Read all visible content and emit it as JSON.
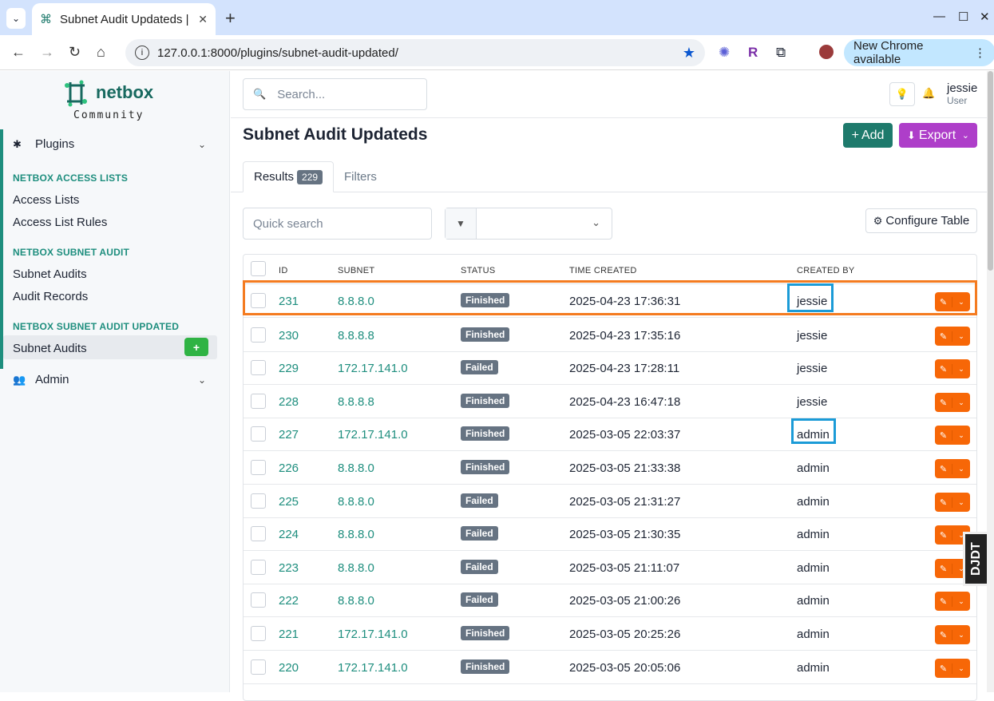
{
  "browser": {
    "tab_title": "Subnet Audit Updateds |",
    "url": "127.0.0.1:8000/plugins/subnet-audit-updated/",
    "new_chrome": "New Chrome available"
  },
  "sidebar": {
    "logo_word": "netbox",
    "logo_sub": "Community",
    "plugins_label": "Plugins",
    "sections": [
      {
        "title": "NETBOX ACCESS LISTS",
        "items": [
          "Access Lists",
          "Access List Rules"
        ]
      },
      {
        "title": "NETBOX SUBNET AUDIT",
        "items": [
          "Subnet Audits",
          "Audit Records"
        ]
      },
      {
        "title": "NETBOX SUBNET AUDIT UPDATED",
        "items": [
          "Subnet Audits"
        ]
      }
    ],
    "admin_label": "Admin"
  },
  "header": {
    "search_placeholder": "Search...",
    "user_name": "jessie",
    "user_role": "User"
  },
  "page": {
    "title": "Subnet Audit Updateds",
    "add_label": "Add",
    "export_label": "Export",
    "tab_results": "Results",
    "results_count": "229",
    "tab_filters": "Filters",
    "quick_search_placeholder": "Quick search",
    "configure_table": "Configure Table"
  },
  "table": {
    "columns": [
      "ID",
      "SUBNET",
      "STATUS",
      "TIME CREATED",
      "CREATED BY"
    ],
    "rows": [
      {
        "id": "231",
        "subnet": "8.8.8.0",
        "status": "Finished",
        "time": "2025-04-23 17:36:31",
        "by": "jessie"
      },
      {
        "id": "230",
        "subnet": "8.8.8.8",
        "status": "Finished",
        "time": "2025-04-23 17:35:16",
        "by": "jessie"
      },
      {
        "id": "229",
        "subnet": "172.17.141.0",
        "status": "Failed",
        "time": "2025-04-23 17:28:11",
        "by": "jessie"
      },
      {
        "id": "228",
        "subnet": "8.8.8.8",
        "status": "Finished",
        "time": "2025-04-23 16:47:18",
        "by": "jessie"
      },
      {
        "id": "227",
        "subnet": "172.17.141.0",
        "status": "Finished",
        "time": "2025-03-05 22:03:37",
        "by": "admin"
      },
      {
        "id": "226",
        "subnet": "8.8.8.0",
        "status": "Finished",
        "time": "2025-03-05 21:33:38",
        "by": "admin"
      },
      {
        "id": "225",
        "subnet": "8.8.8.0",
        "status": "Failed",
        "time": "2025-03-05 21:31:27",
        "by": "admin"
      },
      {
        "id": "224",
        "subnet": "8.8.8.0",
        "status": "Failed",
        "time": "2025-03-05 21:30:35",
        "by": "admin"
      },
      {
        "id": "223",
        "subnet": "8.8.8.0",
        "status": "Failed",
        "time": "2025-03-05 21:11:07",
        "by": "admin"
      },
      {
        "id": "222",
        "subnet": "8.8.8.0",
        "status": "Failed",
        "time": "2025-03-05 21:00:26",
        "by": "admin"
      },
      {
        "id": "221",
        "subnet": "172.17.141.0",
        "status": "Finished",
        "time": "2025-03-05 20:25:26",
        "by": "admin"
      },
      {
        "id": "220",
        "subnet": "172.17.141.0",
        "status": "Finished",
        "time": "2025-03-05 20:05:06",
        "by": "admin"
      }
    ]
  },
  "toolbar_badge": "DJDT",
  "colors": {
    "brand": "#1e7a6c",
    "export": "#ae3ec9",
    "action": "#f76707",
    "highlight_orange": "#f47b20",
    "highlight_blue": "#1b9bd7"
  }
}
